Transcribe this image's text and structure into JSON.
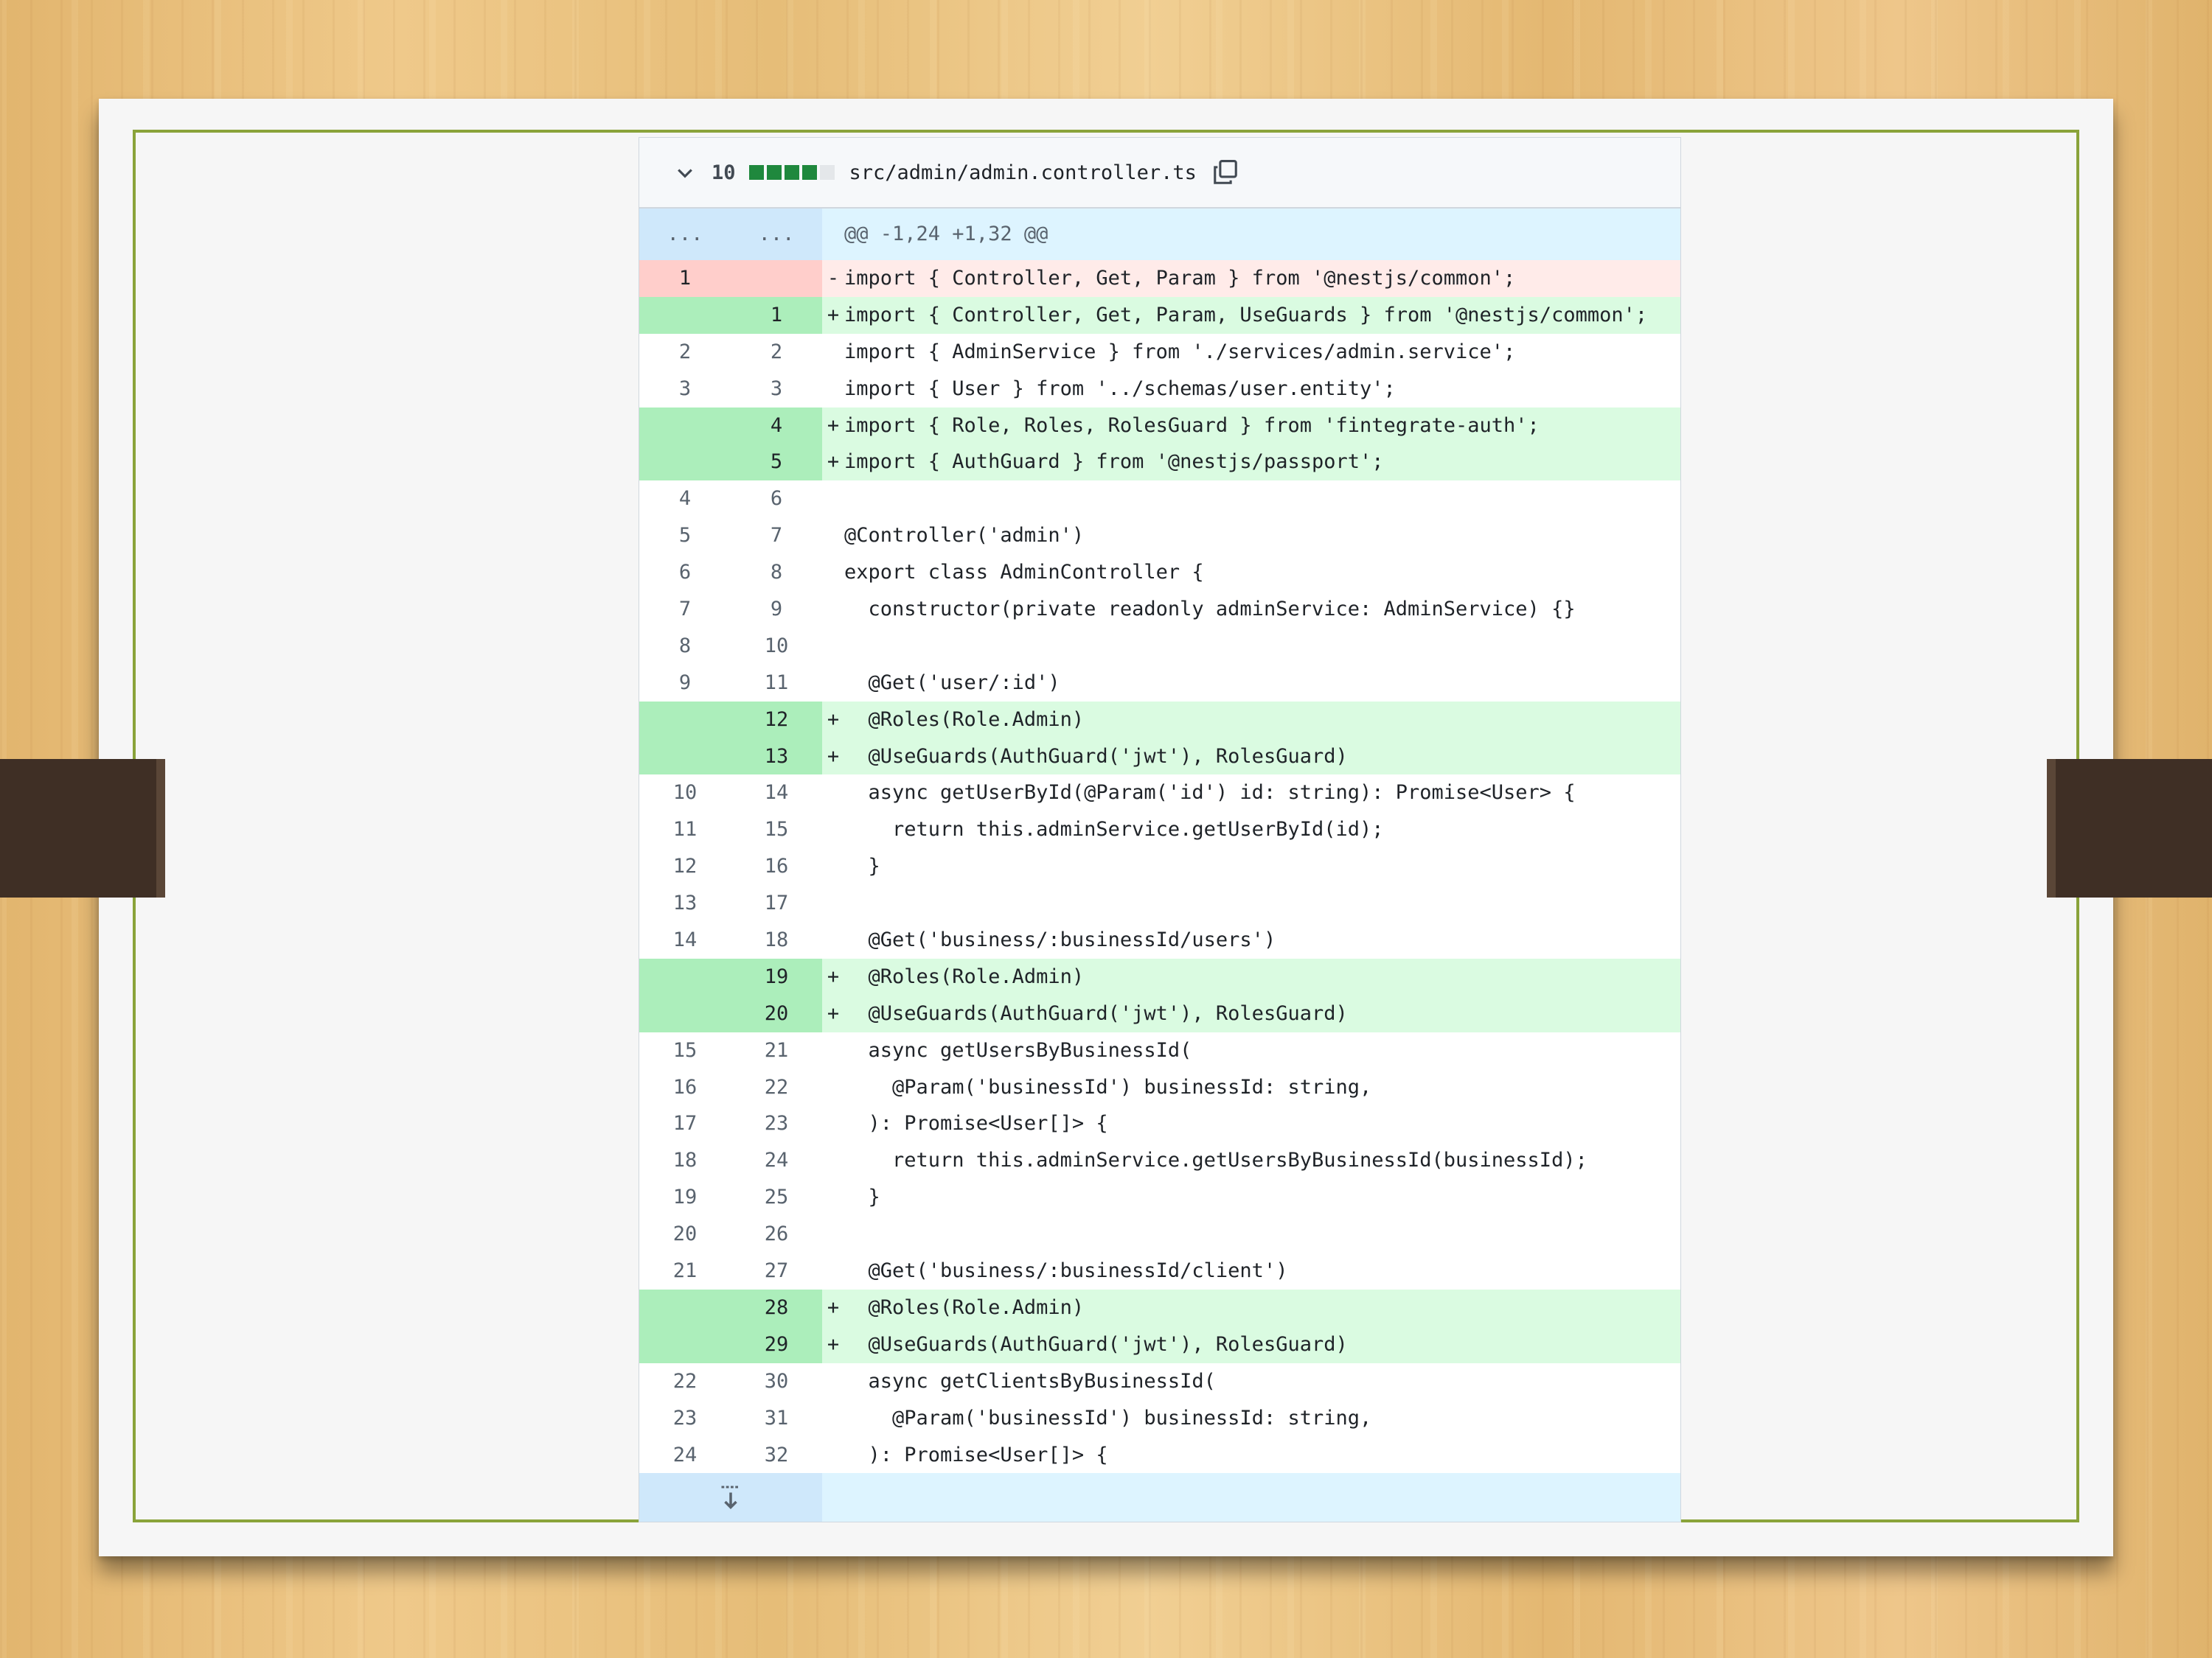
{
  "header": {
    "changes": "10",
    "file_path": "src/admin/admin.controller.ts"
  },
  "hunk_label": "@@ -1,24 +1,32 @@",
  "ellipsis": "...",
  "lines": [
    {
      "type": "del",
      "old": "1",
      "new": "",
      "sign": "-",
      "code": "import { Controller, Get, Param } from '@nestjs/common';"
    },
    {
      "type": "add",
      "old": "",
      "new": "1",
      "sign": "+",
      "code": "import { Controller, Get, Param, UseGuards } from '@nestjs/common';"
    },
    {
      "type": "ctx",
      "old": "2",
      "new": "2",
      "sign": "",
      "code": "import { AdminService } from './services/admin.service';"
    },
    {
      "type": "ctx",
      "old": "3",
      "new": "3",
      "sign": "",
      "code": "import { User } from '../schemas/user.entity';"
    },
    {
      "type": "add",
      "old": "",
      "new": "4",
      "sign": "+",
      "code": "import { Role, Roles, RolesGuard } from 'fintegrate-auth';"
    },
    {
      "type": "add",
      "old": "",
      "new": "5",
      "sign": "+",
      "code": "import { AuthGuard } from '@nestjs/passport';"
    },
    {
      "type": "ctx",
      "old": "4",
      "new": "6",
      "sign": "",
      "code": ""
    },
    {
      "type": "ctx",
      "old": "5",
      "new": "7",
      "sign": "",
      "code": "@Controller('admin')"
    },
    {
      "type": "ctx",
      "old": "6",
      "new": "8",
      "sign": "",
      "code": "export class AdminController {"
    },
    {
      "type": "ctx",
      "old": "7",
      "new": "9",
      "sign": "",
      "code": "  constructor(private readonly adminService: AdminService) {}"
    },
    {
      "type": "ctx",
      "old": "8",
      "new": "10",
      "sign": "",
      "code": ""
    },
    {
      "type": "ctx",
      "old": "9",
      "new": "11",
      "sign": "",
      "code": "  @Get('user/:id')"
    },
    {
      "type": "add",
      "old": "",
      "new": "12",
      "sign": "+",
      "code": "  @Roles(Role.Admin)"
    },
    {
      "type": "add",
      "old": "",
      "new": "13",
      "sign": "+",
      "code": "  @UseGuards(AuthGuard('jwt'), RolesGuard)"
    },
    {
      "type": "ctx",
      "old": "10",
      "new": "14",
      "sign": "",
      "code": "  async getUserById(@Param('id') id: string): Promise<User> {"
    },
    {
      "type": "ctx",
      "old": "11",
      "new": "15",
      "sign": "",
      "code": "    return this.adminService.getUserById(id);"
    },
    {
      "type": "ctx",
      "old": "12",
      "new": "16",
      "sign": "",
      "code": "  }"
    },
    {
      "type": "ctx",
      "old": "13",
      "new": "17",
      "sign": "",
      "code": ""
    },
    {
      "type": "ctx",
      "old": "14",
      "new": "18",
      "sign": "",
      "code": "  @Get('business/:businessId/users')"
    },
    {
      "type": "add",
      "old": "",
      "new": "19",
      "sign": "+",
      "code": "  @Roles(Role.Admin)"
    },
    {
      "type": "add",
      "old": "",
      "new": "20",
      "sign": "+",
      "code": "  @UseGuards(AuthGuard('jwt'), RolesGuard)"
    },
    {
      "type": "ctx",
      "old": "15",
      "new": "21",
      "sign": "",
      "code": "  async getUsersByBusinessId("
    },
    {
      "type": "ctx",
      "old": "16",
      "new": "22",
      "sign": "",
      "code": "    @Param('businessId') businessId: string,"
    },
    {
      "type": "ctx",
      "old": "17",
      "new": "23",
      "sign": "",
      "code": "  ): Promise<User[]> {"
    },
    {
      "type": "ctx",
      "old": "18",
      "new": "24",
      "sign": "",
      "code": "    return this.adminService.getUsersByBusinessId(businessId);"
    },
    {
      "type": "ctx",
      "old": "19",
      "new": "25",
      "sign": "",
      "code": "  }"
    },
    {
      "type": "ctx",
      "old": "20",
      "new": "26",
      "sign": "",
      "code": ""
    },
    {
      "type": "ctx",
      "old": "21",
      "new": "27",
      "sign": "",
      "code": "  @Get('business/:businessId/client')"
    },
    {
      "type": "add",
      "old": "",
      "new": "28",
      "sign": "+",
      "code": "  @Roles(Role.Admin)"
    },
    {
      "type": "add",
      "old": "",
      "new": "29",
      "sign": "+",
      "code": "  @UseGuards(AuthGuard('jwt'), RolesGuard)"
    },
    {
      "type": "ctx",
      "old": "22",
      "new": "30",
      "sign": "",
      "code": "  async getClientsByBusinessId("
    },
    {
      "type": "ctx",
      "old": "23",
      "new": "31",
      "sign": "",
      "code": "    @Param('businessId') businessId: string,"
    },
    {
      "type": "ctx",
      "old": "24",
      "new": "32",
      "sign": "",
      "code": "  ): Promise<User[]> {"
    }
  ],
  "colors": {
    "frame": "#8aa33a",
    "added_line_bg": "#dafbe1",
    "added_num_bg": "#aceebb",
    "deleted_line_bg": "#ffebe9",
    "deleted_num_bg": "#ffcecb",
    "hunk_bg": "#ddf4ff"
  },
  "icons": [
    "chevron-down-icon",
    "copy-icon",
    "expand-down-icon"
  ]
}
